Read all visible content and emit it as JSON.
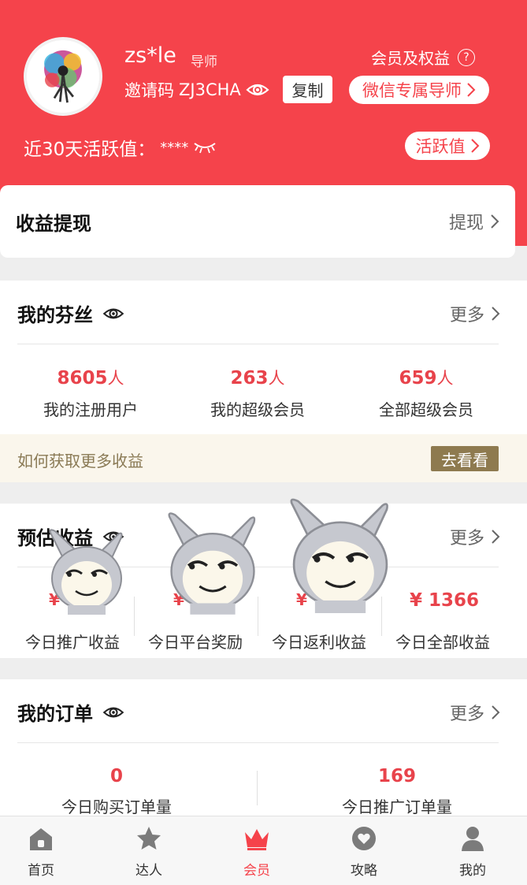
{
  "profile": {
    "username": "zs*le",
    "role": "导师",
    "invite_label": "邀请码",
    "invite_code": "ZJ3CHA",
    "copy_label": "复制",
    "benefits_label": "会员及权益",
    "benefits_help": "?",
    "wechat_mentor_label": "微信专属导师",
    "active_value_label": "近30天活跃值：",
    "active_value_masked": "****",
    "active_value_button": "活跃值"
  },
  "withdraw": {
    "title": "收益提现",
    "action": "提现"
  },
  "fans": {
    "title": "我的芬丝",
    "more": "更多",
    "stats": [
      {
        "value": "8605",
        "unit": "人",
        "label": "我的注册用户"
      },
      {
        "value": "263",
        "unit": "人",
        "label": "我的超级会员"
      },
      {
        "value": "659",
        "unit": "人",
        "label": "全部超级会员"
      }
    ]
  },
  "promo": {
    "text": "如何获取更多收益",
    "button": "去看看"
  },
  "earnings": {
    "title": "预估收益",
    "more": "更多",
    "stats": [
      {
        "value": "¥",
        "label": "今日推广收益"
      },
      {
        "value": "¥",
        "label": "今日平台奖励"
      },
      {
        "value": "¥",
        "label": "今日返利收益"
      },
      {
        "value": "¥ 1366",
        "label": "今日全部收益"
      }
    ]
  },
  "orders": {
    "title": "我的订单",
    "more": "更多",
    "stats": [
      {
        "value": "0",
        "label": "今日购买订单量"
      },
      {
        "value": "169",
        "label": "今日推广订单量"
      }
    ]
  },
  "tabbar": {
    "items": [
      {
        "label": "首页",
        "icon": "home-icon"
      },
      {
        "label": "达人",
        "icon": "star-icon"
      },
      {
        "label": "会员",
        "icon": "crown-icon",
        "active": true
      },
      {
        "label": "攻略",
        "icon": "heart-icon"
      },
      {
        "label": "我的",
        "icon": "person-icon"
      }
    ]
  },
  "colors": {
    "brand_red": "#f5434b",
    "value_red": "#e8434b",
    "gold": "#8e7a4f"
  }
}
